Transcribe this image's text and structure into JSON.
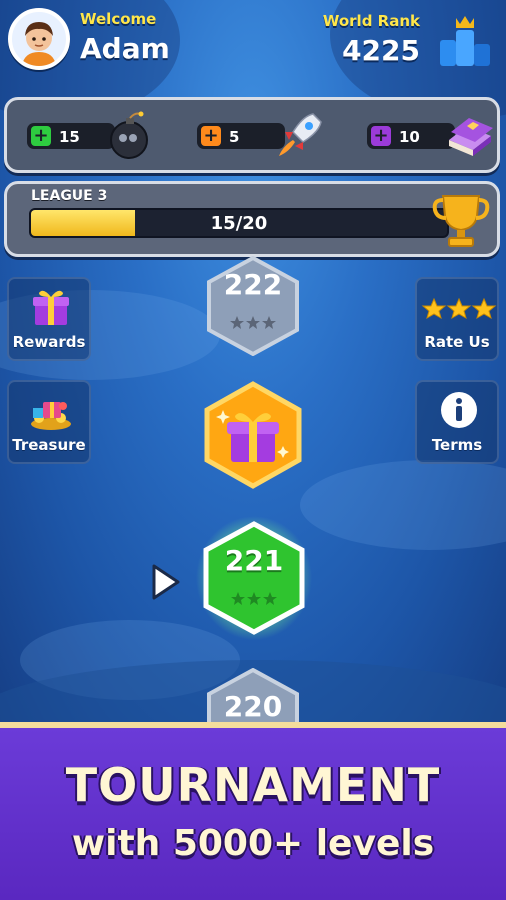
{
  "header": {
    "welcome_label": "Welcome",
    "username": "Adam",
    "rank_label": "World Rank",
    "rank_value": "4225"
  },
  "resources": [
    {
      "count": "15",
      "plus_color": "#2ecc40",
      "icon": "bomb-icon"
    },
    {
      "count": "5",
      "plus_color": "#ff8a1c",
      "icon": "rocket-icon"
    },
    {
      "count": "10",
      "plus_color": "#9b3bd9",
      "icon": "book-icon"
    }
  ],
  "league": {
    "label": "LEAGUE 3",
    "progress_text": "15/20",
    "progress_value": 0.25
  },
  "side_buttons": {
    "rewards": "Rewards",
    "treasure": "Treasure",
    "rate_us": "Rate Us",
    "terms": "Terms"
  },
  "levels": {
    "upcoming": "222",
    "current": "221",
    "previous": "220",
    "upcoming_stars": 0,
    "current_stars": 0
  },
  "banner": {
    "title": "TOURNAMENT",
    "subtitle": "with 5000+ levels"
  },
  "colors": {
    "accent_yellow": "#ffe64a",
    "current_level_green": "#2fc42f",
    "gift_orange": "#ffa712",
    "banner_purple": "#6b3bd8"
  }
}
